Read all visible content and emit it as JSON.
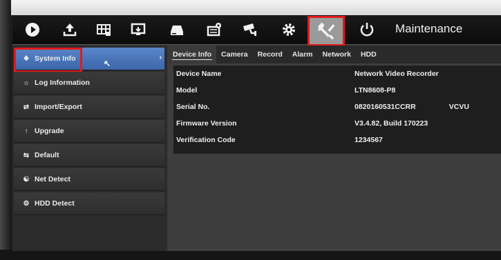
{
  "toolbar": {
    "title": "Maintenance",
    "icons": [
      "play-icon",
      "upload-icon",
      "grid-icon",
      "monitor-icon",
      "disk-icon",
      "camera-settings-icon",
      "cctv-camera-icon",
      "gear-icon",
      "tools-icon",
      "power-icon"
    ],
    "active_icon": "tools-icon",
    "highlight_color": "#e01b1b"
  },
  "sidebar": {
    "items": [
      {
        "label": "System Info",
        "icon": "info-icon"
      },
      {
        "label": "Log Information",
        "icon": "log-icon"
      },
      {
        "label": "Import/Export",
        "icon": "import-export-icon"
      },
      {
        "label": "Upgrade",
        "icon": "upgrade-icon"
      },
      {
        "label": "Default",
        "icon": "default-icon"
      },
      {
        "label": "Net Detect",
        "icon": "net-detect-icon"
      },
      {
        "label": "HDD Detect",
        "icon": "hdd-detect-icon"
      }
    ],
    "selected": "System Info",
    "selected_color": "#4a76bb"
  },
  "tabs": [
    {
      "label": "Device Info"
    },
    {
      "label": "Camera"
    },
    {
      "label": "Record"
    },
    {
      "label": "Alarm"
    },
    {
      "label": "Network"
    },
    {
      "label": "HDD"
    }
  ],
  "device_info": {
    "rows": [
      {
        "label": "Device Name",
        "value": "Network Video Recorder"
      },
      {
        "label": "Model",
        "value": "LTN8608-P8"
      },
      {
        "label": "Serial No.",
        "value": "0820160531CCRR",
        "value_suffix": "VCVU"
      },
      {
        "label": "Firmware Version",
        "value": "V3.4.82, Build 170223"
      },
      {
        "label": "Verification Code",
        "value": "1234567"
      }
    ]
  }
}
